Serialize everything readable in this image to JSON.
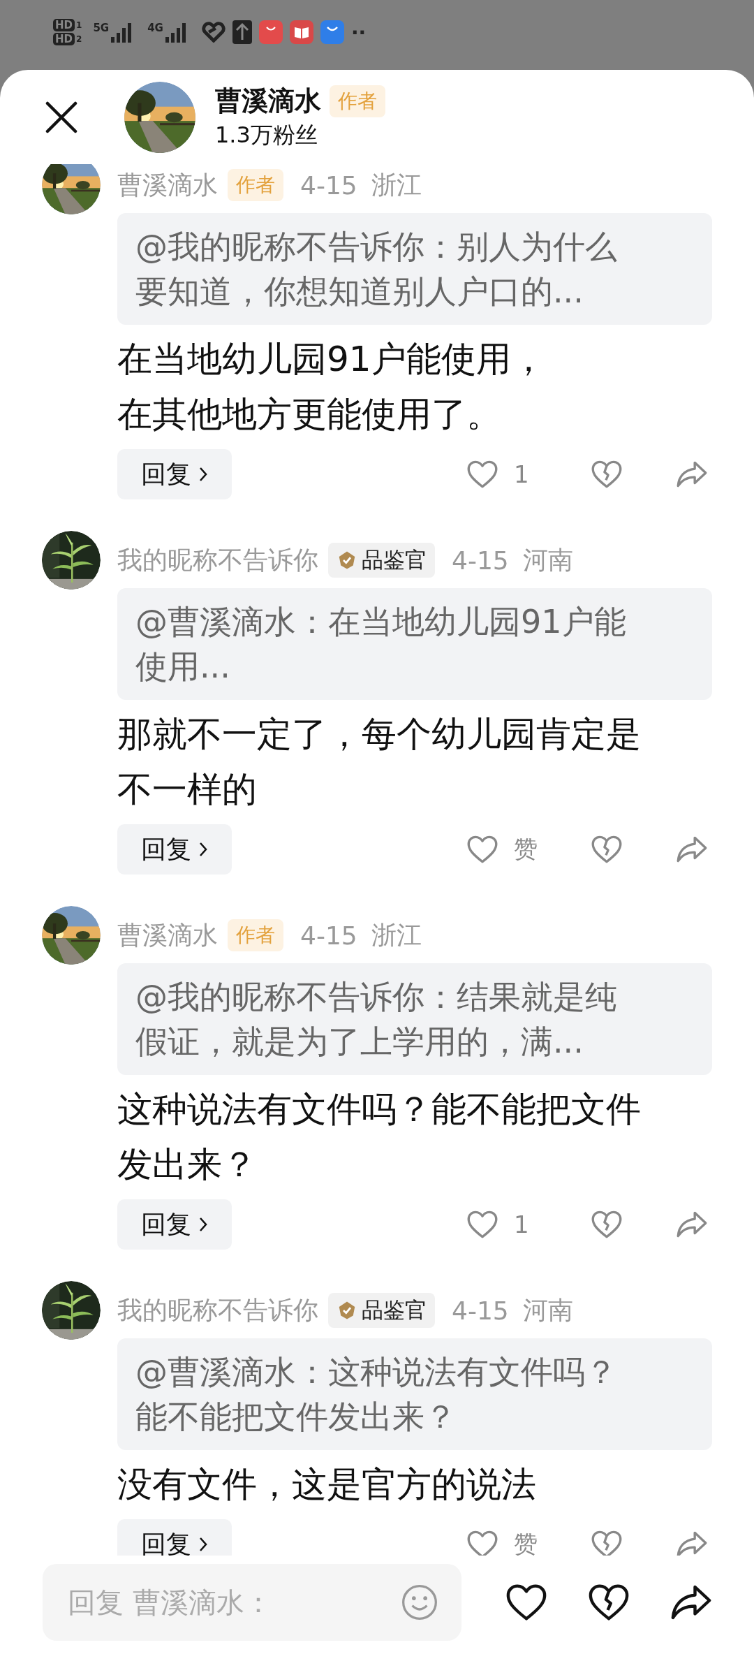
{
  "status_bar": {
    "sims": [
      {
        "label": "HD",
        "slot": "1"
      },
      {
        "label": "HD",
        "slot": "2"
      }
    ],
    "networks": [
      "5G",
      "4G"
    ],
    "more": "··"
  },
  "header": {
    "name": "曹溪滴水",
    "badge": "作者",
    "followers": "1.3万粉丝"
  },
  "comments": [
    {
      "author": "曹溪滴水",
      "kind": "author",
      "badge": "作者",
      "date": "4-15",
      "region": "浙江",
      "quote": [
        "@我的昵称不告诉你：别人为什么",
        "要知道，你想知道别人户口的..."
      ],
      "text": [
        "在当地幼儿园91户能使用，",
        "在其他地方更能使用了。"
      ],
      "reply": "回复",
      "likes": "1"
    },
    {
      "author": "我的昵称不告诉你",
      "kind": "critic",
      "badge": "品鉴官",
      "date": "4-15",
      "region": "河南",
      "quote": [
        "@曹溪滴水：在当地幼儿园91户能",
        "使用..."
      ],
      "text": [
        "那就不一定了，每个幼儿园肯定是",
        "不一样的"
      ],
      "reply": "回复",
      "likes": "赞"
    },
    {
      "author": "曹溪滴水",
      "kind": "author",
      "badge": "作者",
      "date": "4-15",
      "region": "浙江",
      "quote": [
        "@我的昵称不告诉你：结果就是纯",
        "假证，就是为了上学用的，满..."
      ],
      "text": [
        "这种说法有文件吗？能不能把文件",
        "发出来？"
      ],
      "reply": "回复",
      "likes": "1"
    },
    {
      "author": "我的昵称不告诉你",
      "kind": "critic",
      "badge": "品鉴官",
      "date": "4-15",
      "region": "河南",
      "quote": [
        "@曹溪滴水：这种说法有文件吗？",
        "能不能把文件发出来？"
      ],
      "text": [
        "没有文件，这是官方的说法"
      ],
      "reply": "回复",
      "likes": "赞"
    }
  ],
  "reply_bar": {
    "placeholder": "回复 曹溪滴水："
  }
}
